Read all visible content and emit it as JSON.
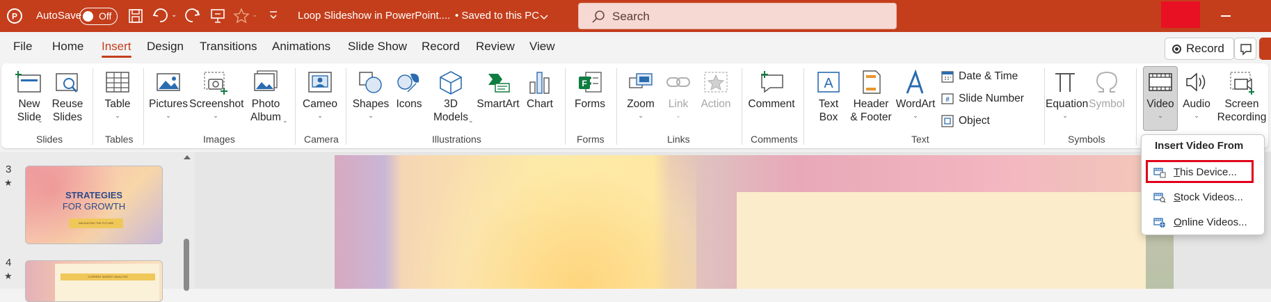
{
  "titlebar": {
    "autosave_label": "AutoSave",
    "autosave_state": "Off",
    "doc_title": "Loop Slideshow in PowerPoint....",
    "save_status": "• Saved to this PC",
    "search_placeholder": "Search",
    "minimize_glyph": "−"
  },
  "tabs": [
    "File",
    "Home",
    "Insert",
    "Design",
    "Transitions",
    "Animations",
    "Slide Show",
    "Record",
    "Review",
    "View"
  ],
  "active_tab": "Insert",
  "record_button": "Record",
  "ribbon": {
    "slides": {
      "new_slide": "New\nSlide",
      "reuse_slides": "Reuse\nSlides",
      "group": "Slides"
    },
    "tables": {
      "table": "Table",
      "group": "Tables"
    },
    "images": {
      "pictures": "Pictures",
      "screenshot": "Screenshot",
      "photo_album": "Photo\nAlbum",
      "group": "Images"
    },
    "camera": {
      "cameo": "Cameo",
      "group": "Camera"
    },
    "illustrations": {
      "shapes": "Shapes",
      "icons": "Icons",
      "models_3d": "3D\nModels",
      "smartart": "SmartArt",
      "chart": "Chart",
      "group": "Illustrations"
    },
    "forms": {
      "forms": "Forms",
      "group": "Forms"
    },
    "links": {
      "zoom": "Zoom",
      "link": "Link",
      "action": "Action",
      "group": "Links"
    },
    "comments": {
      "comment": "Comment",
      "group": "Comments"
    },
    "text": {
      "text_box": "Text\nBox",
      "header_footer": "Header\n& Footer",
      "wordart": "WordArt",
      "date_time": "Date & Time",
      "slide_number": "Slide Number",
      "object": "Object",
      "group": "Text"
    },
    "symbols": {
      "equation": "Equation",
      "symbol": "Symbol",
      "group": "Symbols"
    },
    "media": {
      "video": "Video",
      "audio": "Audio",
      "screen_recording": "Screen\nRecording"
    }
  },
  "slides_panel": {
    "slide3_num": "3",
    "slide3_title1": "STRATEGIES",
    "slide3_title2": "FOR GROWTH",
    "slide3_sub": "NAVIGATING THE FUTURE",
    "slide4_num": "4",
    "slide4_sub": "CURRENT MARKET ANALYSIS",
    "star": "★"
  },
  "video_menu": {
    "header": "Insert Video From",
    "this_device_first": "T",
    "this_device_rest": "his Device...",
    "stock_first": "S",
    "stock_rest": "tock Videos...",
    "online_first": "O",
    "online_rest": "nline Videos..."
  },
  "colors": {
    "accent": "#c43e1c",
    "highlight": "#e0001b",
    "icon_blue": "#2b6cb0",
    "icon_green": "#107c41"
  }
}
